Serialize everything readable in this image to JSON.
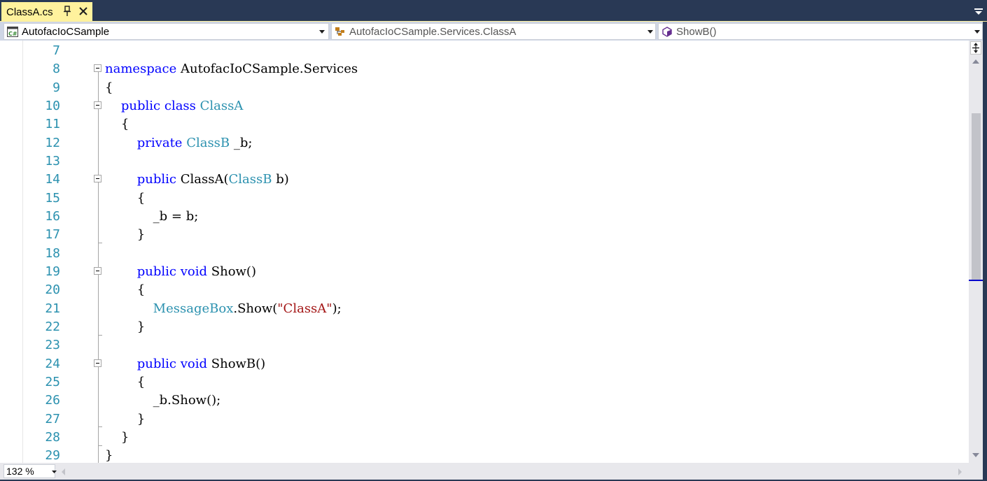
{
  "tab": {
    "title": "ClassA.cs",
    "pin_icon": "pin-icon",
    "close_icon": "close-icon",
    "tab_color": "#fff29d"
  },
  "nav": {
    "project": "AutofacIoCSample",
    "type": "AutofacIoCSample.Services.ClassA",
    "member": "ShowB()",
    "project_icon": "csharp-project-icon",
    "type_icon": "class-icon",
    "member_icon": "method-icon"
  },
  "editor": {
    "line_numbers": [
      "7",
      "8",
      "9",
      "10",
      "11",
      "12",
      "13",
      "14",
      "15",
      "16",
      "17",
      "18",
      "19",
      "20",
      "21",
      "22",
      "23",
      "24",
      "25",
      "26",
      "27",
      "28",
      "29"
    ],
    "lines": [
      [],
      [
        {
          "t": "namespace",
          "c": "kw"
        },
        {
          "t": " AutofacIoCSample.Services",
          "c": ""
        }
      ],
      [
        {
          "t": "{",
          "c": ""
        }
      ],
      [
        {
          "t": "    ",
          "c": ""
        },
        {
          "t": "public",
          "c": "kw"
        },
        {
          "t": " ",
          "c": ""
        },
        {
          "t": "class",
          "c": "kw"
        },
        {
          "t": " ",
          "c": ""
        },
        {
          "t": "ClassA",
          "c": "ty"
        }
      ],
      [
        {
          "t": "    {",
          "c": ""
        }
      ],
      [
        {
          "t": "        ",
          "c": ""
        },
        {
          "t": "private",
          "c": "kw"
        },
        {
          "t": " ",
          "c": ""
        },
        {
          "t": "ClassB",
          "c": "ty"
        },
        {
          "t": " _b;",
          "c": ""
        }
      ],
      [],
      [
        {
          "t": "        ",
          "c": ""
        },
        {
          "t": "public",
          "c": "kw"
        },
        {
          "t": " ClassA(",
          "c": ""
        },
        {
          "t": "ClassB",
          "c": "ty"
        },
        {
          "t": " b)",
          "c": ""
        }
      ],
      [
        {
          "t": "        {",
          "c": ""
        }
      ],
      [
        {
          "t": "            _b = b;",
          "c": ""
        }
      ],
      [
        {
          "t": "        }",
          "c": ""
        }
      ],
      [],
      [
        {
          "t": "        ",
          "c": ""
        },
        {
          "t": "public",
          "c": "kw"
        },
        {
          "t": " ",
          "c": ""
        },
        {
          "t": "void",
          "c": "kw"
        },
        {
          "t": " Show()",
          "c": ""
        }
      ],
      [
        {
          "t": "        {",
          "c": ""
        }
      ],
      [
        {
          "t": "            ",
          "c": ""
        },
        {
          "t": "MessageBox",
          "c": "ty"
        },
        {
          "t": ".Show(",
          "c": ""
        },
        {
          "t": "\"ClassA\"",
          "c": "str"
        },
        {
          "t": ");",
          "c": ""
        }
      ],
      [
        {
          "t": "        }",
          "c": ""
        }
      ],
      [],
      [
        {
          "t": "        ",
          "c": ""
        },
        {
          "t": "public",
          "c": "kw"
        },
        {
          "t": " ",
          "c": ""
        },
        {
          "t": "void",
          "c": "kw"
        },
        {
          "t": " ShowB()",
          "c": ""
        }
      ],
      [
        {
          "t": "        {",
          "c": ""
        }
      ],
      [
        {
          "t": "            _b.Show();",
          "c": ""
        }
      ],
      [
        {
          "t": "        }",
          "c": ""
        }
      ],
      [
        {
          "t": "    }",
          "c": ""
        }
      ],
      [
        {
          "t": "}",
          "c": ""
        }
      ]
    ]
  },
  "status": {
    "zoom": "132 %"
  }
}
